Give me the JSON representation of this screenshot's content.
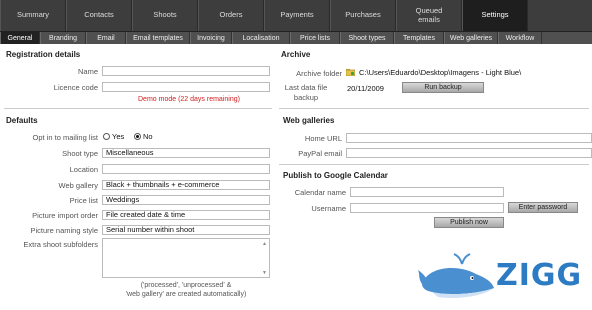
{
  "top_tabs": [
    "Summary",
    "Contacts",
    "Shoots",
    "Orders",
    "Payments",
    "Purchases",
    "Queued\nemails",
    "Settings"
  ],
  "top_active": "Settings",
  "sub_tabs": [
    "General",
    "Branding",
    "Email",
    "Email templates",
    "Invoicing",
    "Localisation",
    "Price lists",
    "Shoot types",
    "Templates",
    "Web galleries",
    "Workflow"
  ],
  "sub_active": "General",
  "registration": {
    "title": "Registration details",
    "name_label": "Name",
    "name_value": "",
    "licence_label": "Licence code",
    "licence_value": "",
    "demo_text": "Demo mode (22 days remaining)"
  },
  "defaults": {
    "title": "Defaults",
    "optin_label": "Opt in to mailing list",
    "optin_yes": "Yes",
    "optin_no": "No",
    "optin_selected": "No",
    "shoot_type_label": "Shoot type",
    "shoot_type_value": "Miscellaneous",
    "location_label": "Location",
    "location_value": "",
    "web_gallery_label": "Web gallery",
    "web_gallery_value": "Black + thumbnails + e-commerce",
    "price_list_label": "Price list",
    "price_list_value": "Weddings",
    "import_order_label": "Picture import order",
    "import_order_value": "File created date & time",
    "naming_label": "Picture naming style",
    "naming_value": "Serial number within shoot",
    "subfolders_label": "Extra shoot subfolders",
    "subfolders_note": "('processed', 'unprocessed' &\n'web gallery' are created automatically)"
  },
  "archive": {
    "title": "Archive",
    "folder_label": "Archive folder",
    "folder_value": "C:\\Users\\Eduardo\\Desktop\\Imagens - Light Blue\\",
    "backup_label": "Last data file\nbackup",
    "backup_value": "20/11/2009",
    "run_backup": "Run backup"
  },
  "web_galleries": {
    "title": "Web galleries",
    "home_url_label": "Home URL",
    "home_url_value": "",
    "paypal_label": "PayPal email",
    "paypal_value": ""
  },
  "google": {
    "title": "Publish to Google Calendar",
    "calendar_label": "Calendar name",
    "calendar_value": "",
    "username_label": "Username",
    "username_value": "",
    "enter_password": "Enter password",
    "publish_now": "Publish now"
  },
  "watermark": {
    "text": "ZIGG",
    "color": "#2d7cc3"
  }
}
